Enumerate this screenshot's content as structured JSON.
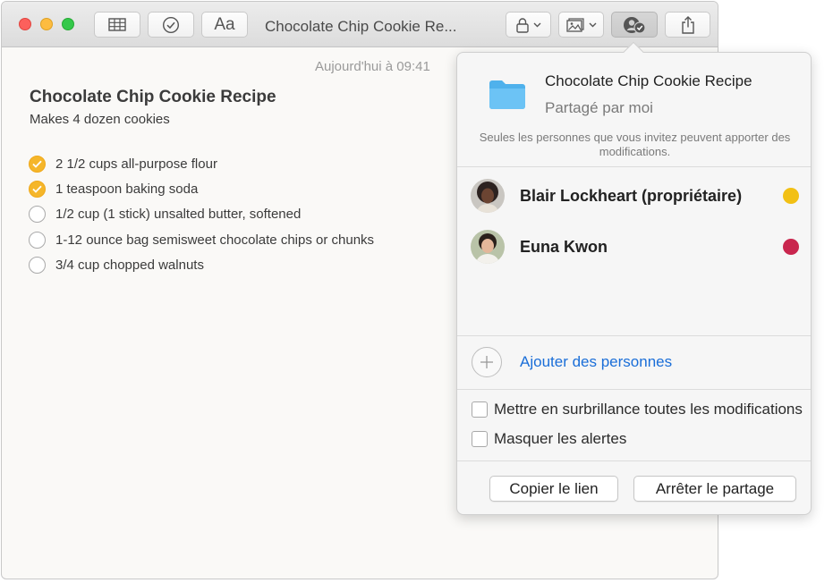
{
  "window": {
    "title": "Chocolate Chip Cookie Re...",
    "timestamp": "Aujourd'hui à 09:41"
  },
  "toolbar": {
    "icons": [
      "table-icon",
      "checklist-icon",
      "format-text-icon",
      "lock-icon",
      "media-icon",
      "collaborate-icon",
      "share-icon"
    ],
    "format_label": "Aa"
  },
  "note": {
    "title": "Chocolate Chip Cookie Recipe",
    "subtitle": "Makes 4 dozen cookies",
    "items": [
      {
        "text": "2 1/2 cups all-purpose flour",
        "checked": true
      },
      {
        "text": "1 teaspoon baking soda",
        "checked": true
      },
      {
        "text": "1/2 cup (1 stick) unsalted butter, softened",
        "checked": false
      },
      {
        "text": "1-12 ounce bag semisweet chocolate chips or chunks",
        "checked": false
      },
      {
        "text": "3/4 cup chopped walnuts",
        "checked": false
      }
    ]
  },
  "popover": {
    "title": "Chocolate Chip Cookie Recipe",
    "subtitle": "Partagé par moi",
    "info": "Seules les personnes que vous invitez peuvent apporter des modifications.",
    "participants": [
      {
        "name": "Blair Lockheart (propriétaire)",
        "color": "#f2c014"
      },
      {
        "name": "Euna Kwon",
        "color": "#c9264e"
      }
    ],
    "add_people": "Ajouter des personnes",
    "options": [
      {
        "label": "Mettre en surbrillance toutes les modifications",
        "checked": false
      },
      {
        "label": "Masquer les alertes",
        "checked": false
      }
    ],
    "copy_link": "Copier le lien",
    "stop_sharing": "Arrêter le partage"
  }
}
